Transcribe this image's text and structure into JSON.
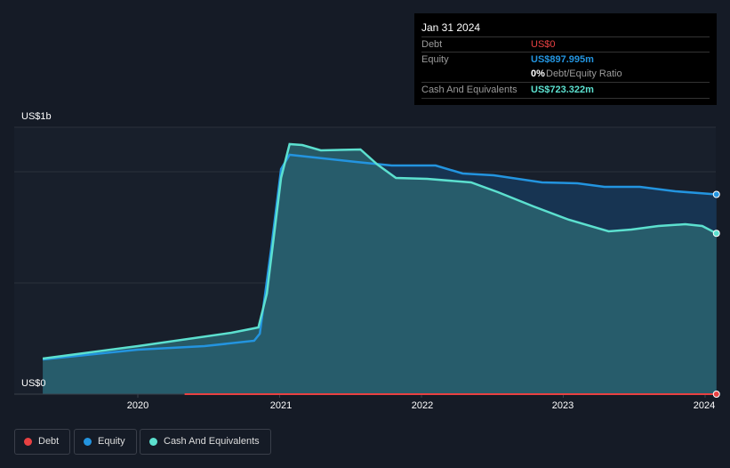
{
  "tooltip": {
    "date": "Jan 31 2024",
    "debt_label": "Debt",
    "debt_value": "US$0",
    "equity_label": "Equity",
    "equity_value": "US$897.995m",
    "ratio_value": "0%",
    "ratio_label": "Debt/Equity Ratio",
    "cash_label": "Cash And Equivalents",
    "cash_value": "US$723.322m"
  },
  "colors": {
    "debt": "#e84142",
    "equity": "#2394df",
    "cash": "#5ce0cf"
  },
  "chart_data": {
    "type": "area",
    "y_unit": "US$ billions",
    "ylim": [
      0,
      1.2
    ],
    "xlim": [
      2019.0,
      2024.15
    ],
    "y_tick_labels": {
      "top": "US$1b",
      "bottom": "US$0"
    },
    "x_ticks": [
      {
        "v": 2020,
        "label": "2020"
      },
      {
        "v": 2021,
        "label": "2021"
      },
      {
        "v": 2022,
        "label": "2022"
      },
      {
        "v": 2023,
        "label": "2023"
      },
      {
        "v": 2024,
        "label": "2024"
      }
    ],
    "legend": [
      "Debt",
      "Equity",
      "Cash And Equivalents"
    ],
    "series": [
      {
        "name": "Debt",
        "x": [
          2020.33,
          2024.08
        ],
        "y": [
          0,
          0
        ]
      },
      {
        "name": "Equity",
        "x": [
          2019.33,
          2020,
          2020.47,
          2020.82,
          2020.86,
          2020.94,
          2021.01,
          2021.07,
          2021.54,
          2021.79,
          2022.1,
          2022.29,
          2022.51,
          2022.85,
          2023.1,
          2023.29,
          2023.54,
          2023.79,
          2024.08
        ],
        "y": [
          0.156,
          0.2,
          0.216,
          0.24,
          0.272,
          0.652,
          1.012,
          1.076,
          1.044,
          1.028,
          1.028,
          0.992,
          0.984,
          0.952,
          0.948,
          0.932,
          0.932,
          0.912,
          0.898
        ]
      },
      {
        "name": "Cash And Equivalents",
        "x": [
          2019.33,
          2020,
          2020.66,
          2020.85,
          2020.91,
          2021.01,
          2021.07,
          2021.16,
          2021.29,
          2021.57,
          2021.69,
          2021.82,
          2022.04,
          2022.35,
          2022.54,
          2022.79,
          2023.04,
          2023.32,
          2023.48,
          2023.67,
          2023.86,
          2023.98,
          2024.08
        ],
        "y": [
          0.16,
          0.216,
          0.276,
          0.3,
          0.452,
          0.972,
          1.124,
          1.12,
          1.096,
          1.1,
          1.032,
          0.972,
          0.968,
          0.952,
          0.908,
          0.844,
          0.784,
          0.732,
          0.74,
          0.756,
          0.764,
          0.756,
          0.723
        ]
      }
    ]
  }
}
